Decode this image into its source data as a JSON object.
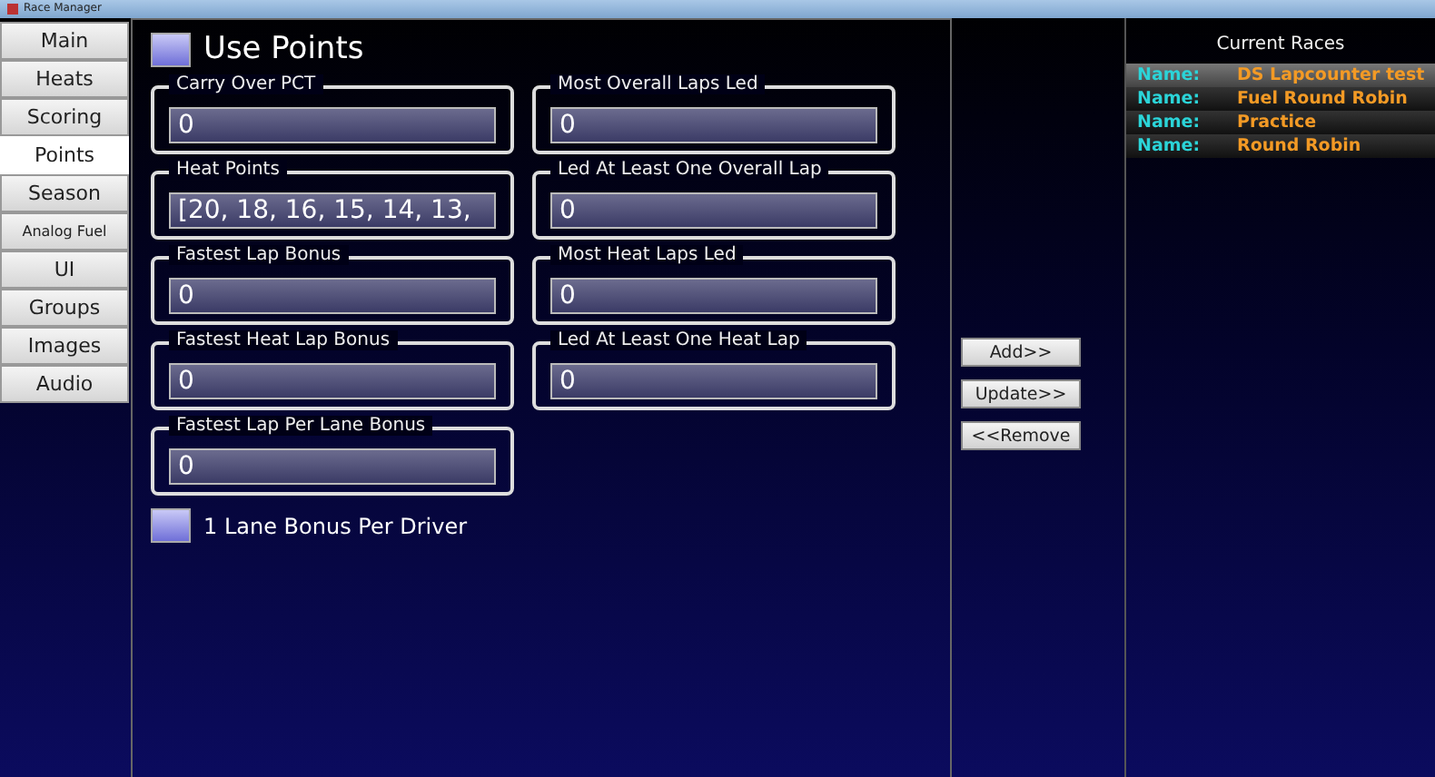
{
  "window": {
    "title": "Race Manager"
  },
  "tabs": [
    {
      "label": "Main",
      "selected": false
    },
    {
      "label": "Heats",
      "selected": false
    },
    {
      "label": "Scoring",
      "selected": false
    },
    {
      "label": "Points",
      "selected": true
    },
    {
      "label": "Season",
      "selected": false
    },
    {
      "label": "Analog Fuel",
      "selected": false
    },
    {
      "label": "UI",
      "selected": false
    },
    {
      "label": "Groups",
      "selected": false
    },
    {
      "label": "Images",
      "selected": false
    },
    {
      "label": "Audio",
      "selected": false
    }
  ],
  "use_points": {
    "label": "Use Points",
    "checked": false
  },
  "left_fields": [
    {
      "label": "Carry Over PCT",
      "value": "0"
    },
    {
      "label": "Heat Points",
      "value": "[20, 18, 16, 15, 14, 13,"
    },
    {
      "label": "Fastest Lap Bonus",
      "value": "0"
    },
    {
      "label": "Fastest Heat Lap Bonus",
      "value": "0"
    },
    {
      "label": "Fastest Lap Per Lane Bonus",
      "value": "0"
    }
  ],
  "right_fields": [
    {
      "label": "Most Overall Laps Led",
      "value": "0"
    },
    {
      "label": "Led At Least One Overall Lap",
      "value": "0"
    },
    {
      "label": "Most Heat Laps Led",
      "value": "0"
    },
    {
      "label": "Led At Least One Heat Lap",
      "value": "0"
    }
  ],
  "lane_bonus": {
    "label": "1 Lane Bonus Per Driver",
    "checked": false
  },
  "buttons": [
    "Add>>",
    "Update>>",
    "<<Remove"
  ],
  "current_races": {
    "title": "Current Races",
    "items": [
      {
        "key": "Name:",
        "name": "DS Lapcounter test",
        "selected": true
      },
      {
        "key": "Name:",
        "name": "Fuel Round Robin",
        "selected": false
      },
      {
        "key": "Name:",
        "name": "Practice",
        "selected": false
      },
      {
        "key": "Name:",
        "name": "Round Robin",
        "selected": false
      }
    ]
  }
}
